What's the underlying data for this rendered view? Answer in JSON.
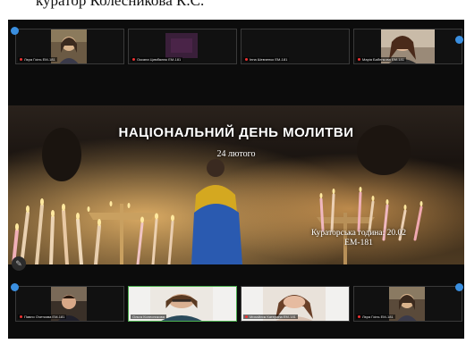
{
  "caption": "куратор Колесникова К.С.",
  "top_row": [
    {
      "name": "Лєра Гоінь ЕМ-181"
    },
    {
      "name": "Оксана Цимбалюк ЕМ-181"
    },
    {
      "name": "Інна Шевченко ЕМ-181"
    },
    {
      "name": "Марія Бабенкова ЕМ-181"
    }
  ],
  "bottom_row": [
    {
      "name": "Павло Очеткова ЕМ-181"
    },
    {
      "name": "Ольга Колесникова"
    },
    {
      "name": "Михайлик Катерина ЕМ-181"
    },
    {
      "name": "Лєра Гоінь ЕМ-181"
    }
  ],
  "slide": {
    "title": "НАЦІОНАЛЬНИЙ ДЕНЬ МОЛИТВИ",
    "date": "24 лютого",
    "note_line1": "Кураторська година: 20.02",
    "note_line2": "ЕМ-181"
  },
  "icons": {
    "annotate": "pen-icon",
    "pin": "pin-dot-icon"
  },
  "colors": {
    "pin": "#3a8fe0",
    "background": "#0c0c0c",
    "mic_muted": "#e33333"
  }
}
